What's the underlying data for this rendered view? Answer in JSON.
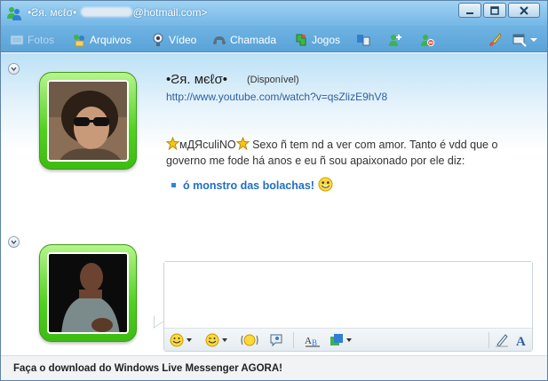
{
  "window": {
    "title_prefix": "•Ƨя. мєℓσ•",
    "title_suffix": "@hotmail.com>"
  },
  "toolbar": {
    "fotos": "Fotos",
    "arquivos": "Arquivos",
    "video": "Vídeo",
    "chamada": "Chamada",
    "jogos": "Jogos"
  },
  "contact": {
    "name": "•Ƨя. мєℓσ•",
    "status": "(Disponível)",
    "personal_message": "http://www.youtube.com/watch?v=qsZlizE9hV8"
  },
  "conversation": {
    "sender": "мДЯculiNO",
    "text_line1": "Sexo ñ tem nd a ver com amor. Tanto é vdd que o",
    "text_line2": "governo me fode há anos e eu ñ sou apaixonado por ele diz:",
    "bullet": "ó monstro das bolachas!"
  },
  "compose": {
    "value": "",
    "placeholder": ""
  },
  "footer": {
    "promo": "Faça o download do Windows Live Messenger AGORA!"
  },
  "colors": {
    "titlebar": "#74b7e6",
    "toolbar": "#5aa3d8",
    "avatar_frame": "#4fd21f",
    "link": "#2c5fa1",
    "bullet_text": "#1f6fc2"
  },
  "icons": [
    "messenger-icon",
    "minimize-icon",
    "maximize-icon",
    "close-icon",
    "photos-icon",
    "files-icon",
    "video-icon",
    "call-icon",
    "games-icon",
    "activities-icon",
    "invite-icon",
    "block-icon",
    "paint-icon",
    "display-menu-icon",
    "emoticon-icon",
    "wink-icon",
    "nudge-icon",
    "voice-clip-icon",
    "font-icon",
    "background-icon",
    "handwriting-icon",
    "text-style-icon"
  ]
}
